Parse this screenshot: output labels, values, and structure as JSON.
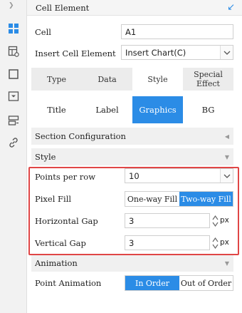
{
  "panel": {
    "title": "Cell Element"
  },
  "cell": {
    "label": "Cell",
    "value": "A1"
  },
  "insert": {
    "label": "Insert Cell Element",
    "value": "Insert Chart(C)"
  },
  "tabs_primary": [
    {
      "label": "Type",
      "active": false
    },
    {
      "label": "Data",
      "active": false
    },
    {
      "label": "Style",
      "active": true
    },
    {
      "label": "Special Effect",
      "active": false
    }
  ],
  "tabs_secondary": [
    {
      "label": "Title",
      "active": false
    },
    {
      "label": "Label",
      "active": false
    },
    {
      "label": "Graphics",
      "active": true
    },
    {
      "label": "BG",
      "active": false
    }
  ],
  "sections": {
    "section_config": "Section Configuration",
    "style": "Style",
    "animation": "Animation"
  },
  "points_per_row": {
    "label": "Points per row",
    "value": "10"
  },
  "pixel_fill": {
    "label": "Pixel Fill",
    "options": [
      "One-way Fill",
      "Two-way Fill"
    ],
    "selected": "Two-way Fill"
  },
  "horizontal_gap": {
    "label": "Horizontal Gap",
    "value": "3",
    "unit": "px"
  },
  "vertical_gap": {
    "label": "Vertical Gap",
    "value": "3",
    "unit": "px"
  },
  "point_animation": {
    "label": "Point Animation",
    "options": [
      "In Order",
      "Out of Order"
    ],
    "selected": "In Order"
  },
  "colors": {
    "accent": "#2b8ce6",
    "highlight_border": "#e04646",
    "section_bg": "#f0f0f0"
  },
  "sidebar_icons": [
    "grid-icon",
    "table-settings-icon",
    "square-icon",
    "dropdown-box-icon",
    "server-icon",
    "link-icon"
  ]
}
